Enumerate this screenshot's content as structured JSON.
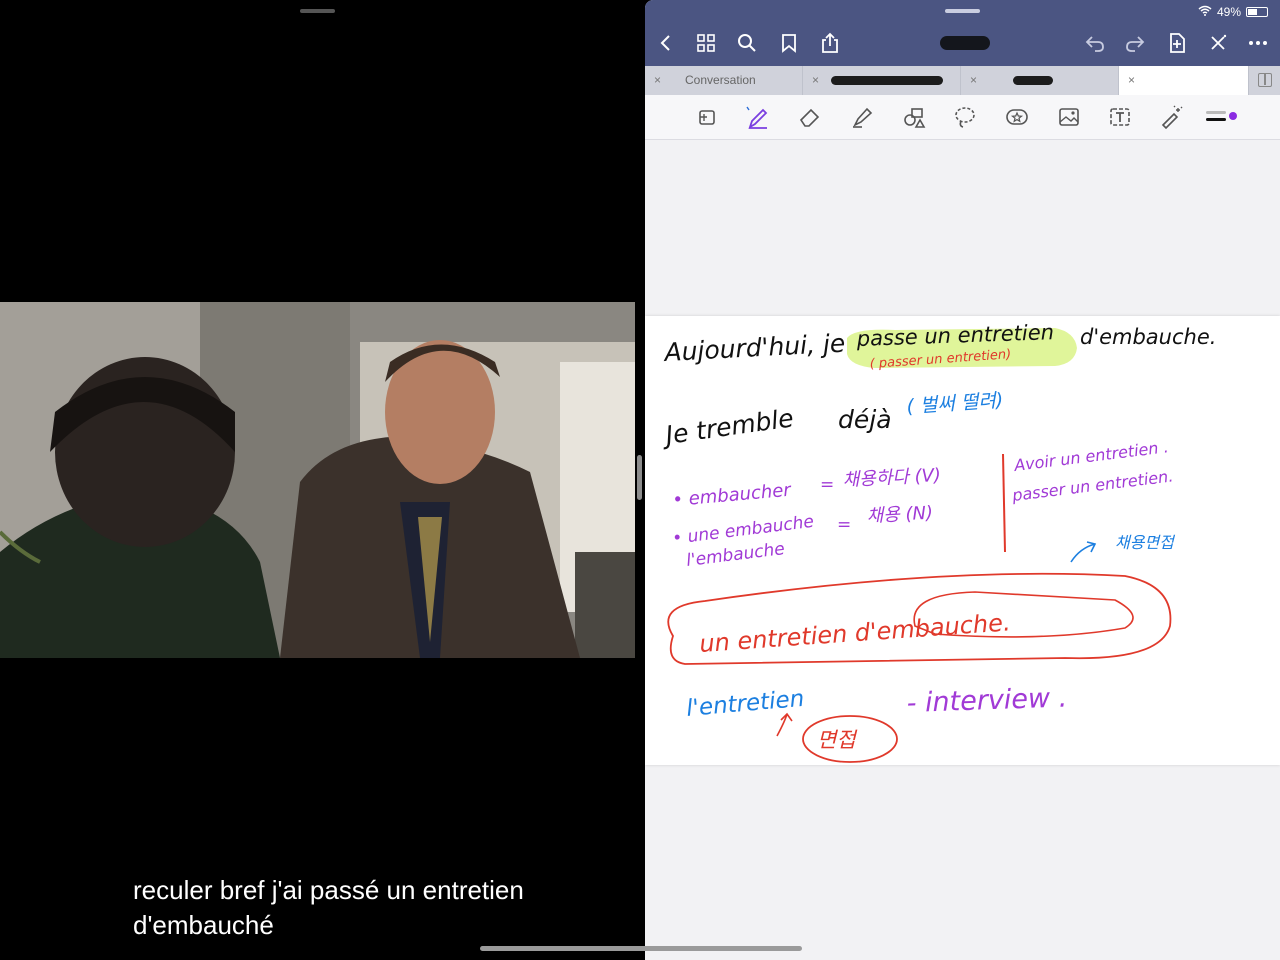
{
  "video": {
    "subtitle_line1": "reculer bref j'ai passé un entretien",
    "subtitle_line2": "d'embauché"
  },
  "status_bar": {
    "battery": "49%"
  },
  "notes_app": {
    "tabs": [
      {
        "label": "Conversation",
        "close": "×"
      },
      {
        "label": "",
        "close": "×"
      },
      {
        "label": "",
        "close": "×"
      },
      {
        "label": "",
        "close": "×"
      }
    ],
    "toolbar_icons": [
      "back-icon",
      "grid-icon",
      "search-icon",
      "bookmark-icon",
      "share-icon",
      "undo-icon",
      "redo-icon",
      "add-page-icon",
      "close-icon",
      "more-icon"
    ],
    "tools": [
      "shapes-icon",
      "pen-icon",
      "eraser-icon",
      "highlighter-icon",
      "shape-tool-icon",
      "lasso-icon",
      "sticker-icon",
      "image-icon",
      "text-icon",
      "laser-icon",
      "color-picker-icon"
    ],
    "accent": "#4b5582",
    "note": {
      "line1_a": "Aujourd'hui, je",
      "line1_b": "passe un entretien",
      "line1_c": "d'embauche.",
      "line1_hint": "( passer un entretien)",
      "line2_a": "Je tremble",
      "line2_b": "déjà",
      "line2_c": "( 벌써 떨려)",
      "vocab1": "• embaucher",
      "vocab1_eq": "=",
      "vocab1_ko": "채용하다 (V)",
      "vocab2": "• une embauche",
      "vocab2b": "l'embauche",
      "vocab2_eq": "=",
      "vocab2_ko": "채용 (N)",
      "right1": "Avoir un entretien .",
      "right2": "passer un entretien.",
      "arrow_ko": "채용면접",
      "phrase": "un entretien d'embauche.",
      "entretien": "l'entretien",
      "interview": "- interview .",
      "ko_interview": "면접"
    }
  }
}
